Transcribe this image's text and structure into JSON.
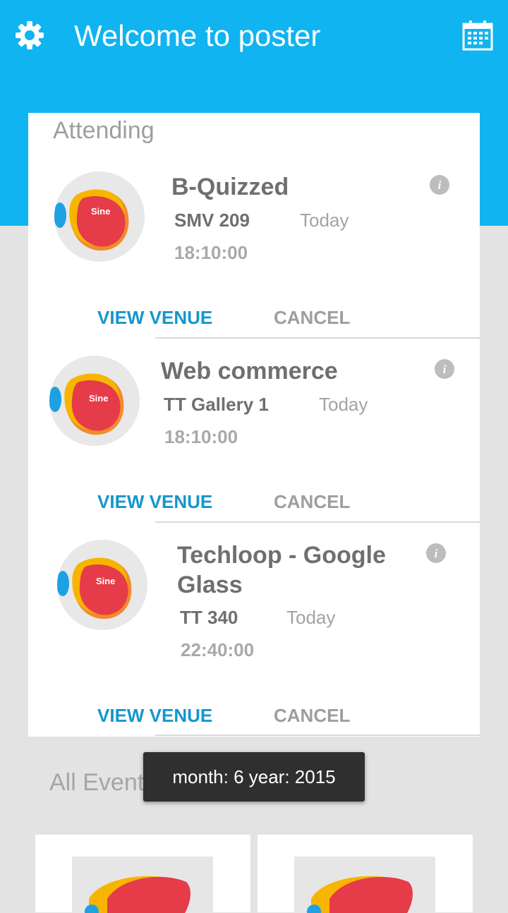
{
  "header": {
    "title": "Welcome to poster",
    "settings_icon": "gear-icon",
    "calendar_icon": "calendar-icon",
    "bg_color": "#0fb4f0"
  },
  "attending": {
    "section_label": "Attending",
    "events": [
      {
        "title": "B-Quizzed",
        "venue": "SMV 209",
        "date": "Today",
        "time": "18:10:00",
        "view_label": "VIEW VENUE",
        "cancel_label": "CANCEL",
        "logo_text": "Sine"
      },
      {
        "title": "Web commerce",
        "venue": "TT Gallery 1",
        "date": "Today",
        "time": "18:10:00",
        "view_label": "VIEW VENUE",
        "cancel_label": "CANCEL",
        "logo_text": "Sine"
      },
      {
        "title": "Techloop - Google Glass",
        "venue": "TT 340",
        "date": "Today",
        "time": "22:40:00",
        "view_label": "VIEW VENUE",
        "cancel_label": "CANCEL",
        "logo_text": "Sine"
      }
    ]
  },
  "all_events": {
    "section_label": "All Events"
  },
  "toast": {
    "text": "month: 6 year: 2015"
  },
  "colors": {
    "accent": "#1596cd",
    "logo_red": "#e63b48",
    "logo_yellow": "#f7b500",
    "logo_blue": "#1da1e3",
    "logo_orange": "#f28b2c"
  }
}
